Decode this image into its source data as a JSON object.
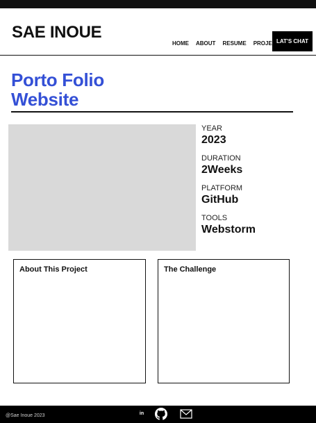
{
  "header": {
    "brand": "SAE INOUE",
    "nav": [
      "HOME",
      "ABOUT",
      "RESUME",
      "PROJECT"
    ],
    "cta": "LAT'S CHAT"
  },
  "page": {
    "title_line1": "Porto Folio",
    "title_line2": "Website"
  },
  "meta": [
    {
      "label": "YEAR",
      "value": "2023"
    },
    {
      "label": "DURATION",
      "value": "2Weeks"
    },
    {
      "label": "PLATFORM",
      "value": "GitHub"
    },
    {
      "label": "TOOLS",
      "value": "Webstorm"
    }
  ],
  "cards": {
    "about_title": "About This Project",
    "challenge_title": "The Challenge"
  },
  "footer": {
    "copyright": "@Sae Inoue 2023",
    "linkedin_text": "in",
    "icons": [
      "linkedin-icon",
      "github-icon",
      "mail-icon"
    ]
  },
  "colors": {
    "accent": "#3450d6",
    "placeholder": "#d9d9d9",
    "footer": "#000000"
  }
}
